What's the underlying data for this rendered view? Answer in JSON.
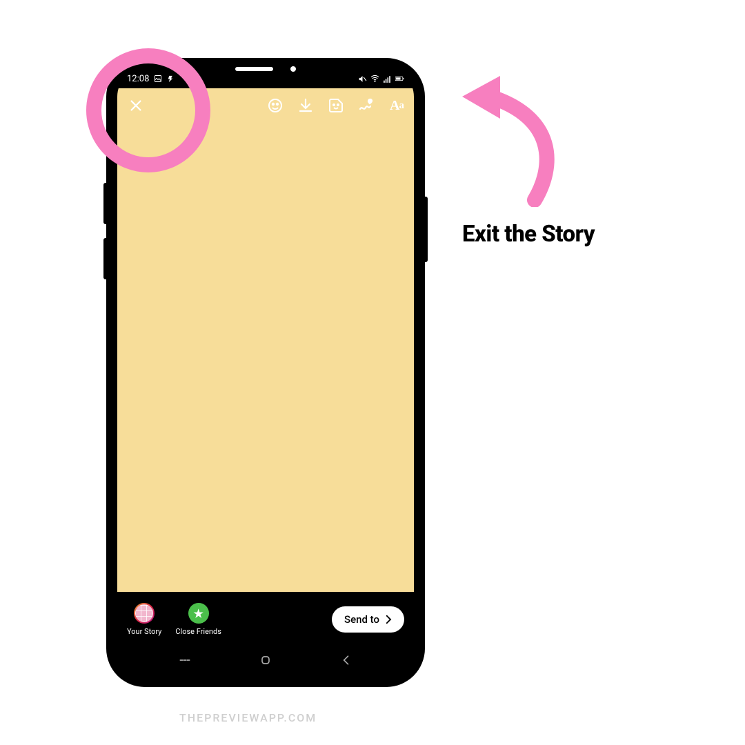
{
  "statusbar": {
    "time": "12:08"
  },
  "toolbar": {
    "text_label": "Aa"
  },
  "footer": {
    "your_story": "Your Story",
    "close_friends": "Close Friends",
    "send_to": "Send to",
    "cf_star": "★"
  },
  "annotation": {
    "callout": "Exit the Story"
  },
  "watermark": "THEPREVIEWAPP.COM",
  "colors": {
    "highlight": "#f77fbf",
    "canvas": "#f7dd99"
  }
}
